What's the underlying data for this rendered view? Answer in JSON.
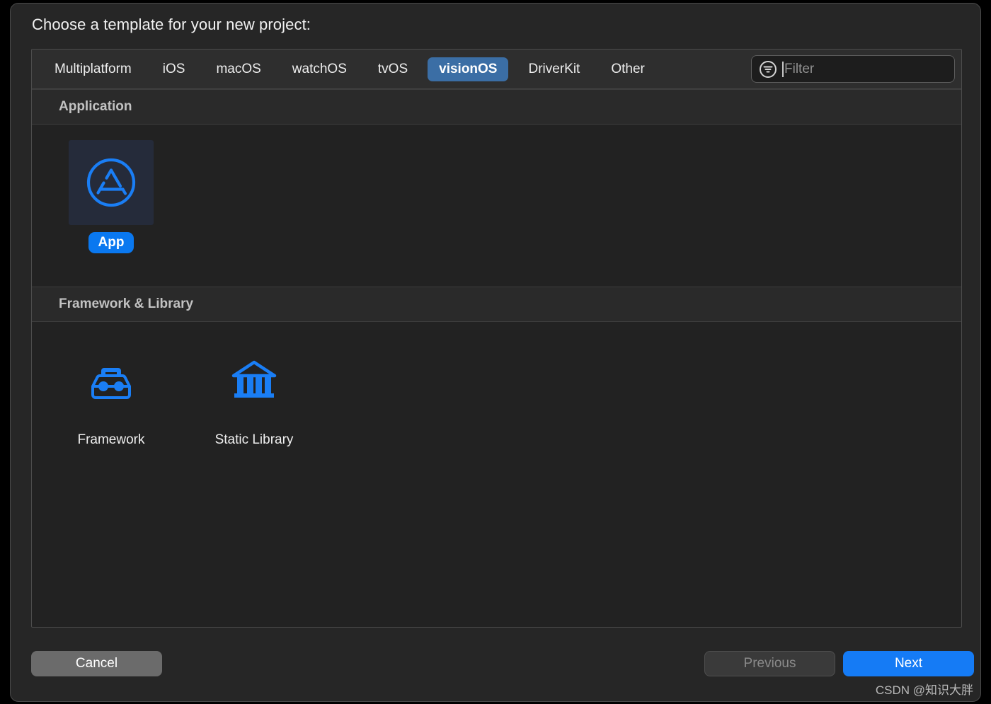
{
  "dialog": {
    "title": "Choose a template for your new project:"
  },
  "tabs": [
    {
      "label": "Multiplatform",
      "selected": false
    },
    {
      "label": "iOS",
      "selected": false
    },
    {
      "label": "macOS",
      "selected": false
    },
    {
      "label": "watchOS",
      "selected": false
    },
    {
      "label": "tvOS",
      "selected": false
    },
    {
      "label": "visionOS",
      "selected": true
    },
    {
      "label": "DriverKit",
      "selected": false
    },
    {
      "label": "Other",
      "selected": false
    }
  ],
  "filter": {
    "icon": "filter-circle-icon",
    "value": "",
    "placeholder": "Filter"
  },
  "sections": [
    {
      "title": "Application",
      "items": [
        {
          "label": "App",
          "icon": "app-store-icon",
          "selected": true
        }
      ]
    },
    {
      "title": "Framework & Library",
      "items": [
        {
          "label": "Framework",
          "icon": "toolbox-icon",
          "selected": false
        },
        {
          "label": "Static Library",
          "icon": "bank-columns-icon",
          "selected": false
        }
      ]
    }
  ],
  "footer": {
    "cancel_label": "Cancel",
    "previous_label": "Previous",
    "next_label": "Next",
    "previous_disabled": true
  },
  "watermark": "CSDN @知识大胖",
  "colors": {
    "accent_blue": "#157bf5",
    "tab_selected": "#3b6ea5",
    "icon_blue": "#1a7ef5",
    "panel_bg": "#222222",
    "dialog_bg": "#262626"
  }
}
